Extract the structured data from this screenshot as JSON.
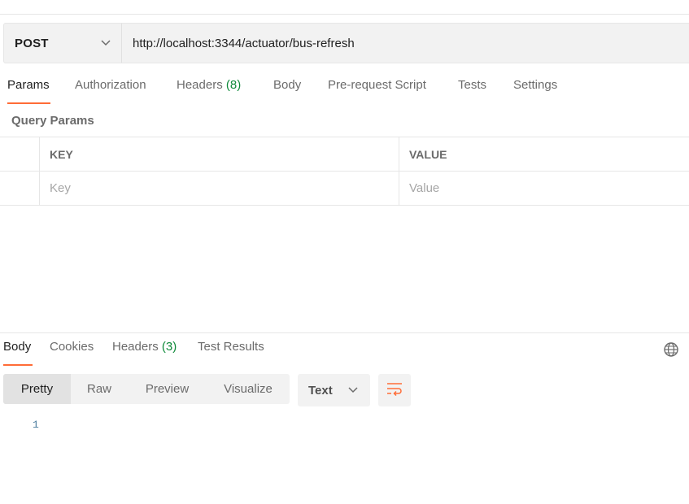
{
  "request": {
    "method": "POST",
    "url": "http://localhost:3344/actuator/bus-refresh"
  },
  "request_tabs": {
    "params": "Params",
    "authorization": "Authorization",
    "headers": "Headers",
    "headers_count": "(8)",
    "body": "Body",
    "prerequest": "Pre-request Script",
    "tests": "Tests",
    "settings": "Settings",
    "active": "Params"
  },
  "query_params": {
    "title": "Query Params",
    "columns": {
      "key": "KEY",
      "value": "VALUE"
    },
    "placeholders": {
      "key": "Key",
      "value": "Value"
    }
  },
  "response": {
    "tabs": {
      "body": "Body",
      "cookies": "Cookies",
      "headers": "Headers",
      "headers_count": "(3)",
      "test_results": "Test Results",
      "active": "Body"
    },
    "view_modes": [
      "Pretty",
      "Raw",
      "Preview",
      "Visualize"
    ],
    "active_view_mode": "Pretty",
    "format": "Text",
    "line_numbers": [
      "1"
    ]
  },
  "icons": {
    "method_dropdown": "chevron-down-icon",
    "format_dropdown": "chevron-down-icon",
    "globe": "globe-icon",
    "wrap": "wrap-lines-icon"
  },
  "colors": {
    "accent": "#ff6c37",
    "count_green": "#0f8a3a",
    "line_number": "#4a7c9e"
  }
}
